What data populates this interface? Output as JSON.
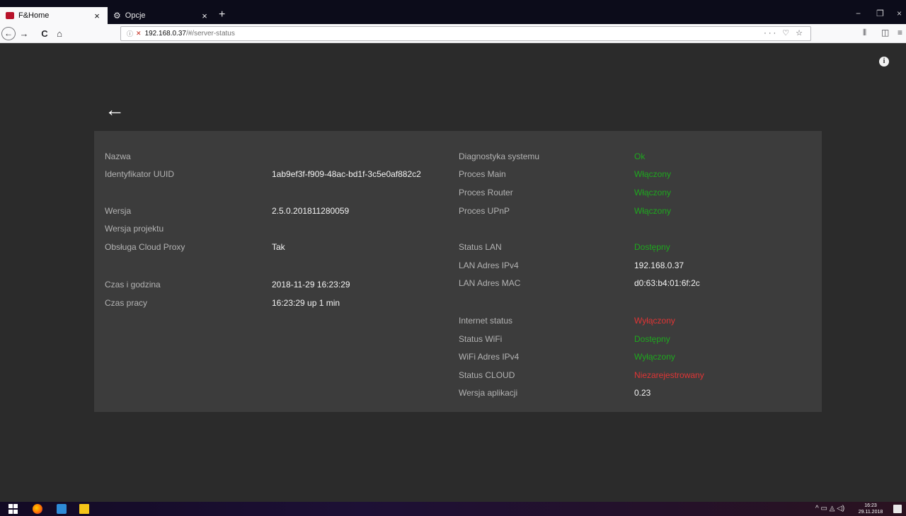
{
  "browser": {
    "tabs": [
      {
        "label": "F&Home"
      },
      {
        "label": "Opcje"
      }
    ],
    "new_tab": "+",
    "tab_close": "×",
    "window_controls": {
      "minimize": "−",
      "restore": "❐",
      "close": "×"
    },
    "nav": {
      "back": "←",
      "forward": "→",
      "reload": "C",
      "home": "⌂"
    },
    "url": {
      "info_glyph": "ⓘ",
      "host": "192.168.0.37",
      "path": "/#/server-status"
    },
    "url_actions": "··· ♡ ☆",
    "toolbar_right": {
      "library": "⫴",
      "sidebar": "◫",
      "menu": "≡"
    }
  },
  "page": {
    "info_icon": "i",
    "back_arrow": "←",
    "left_column": [
      {
        "label": "Nazwa",
        "value": ""
      },
      {
        "label": "Identyfikator UUID",
        "value": "1ab9ef3f-f909-48ac-bd1f-3c5e0af882c2"
      },
      {
        "label": "Wersja",
        "value": "2.5.0.201811280059"
      },
      {
        "label": "Wersja projektu",
        "value": ""
      },
      {
        "label": "Obsługa Cloud Proxy",
        "value": "Tak"
      },
      {
        "label": "Czas i godzina",
        "value": "2018-11-29 16:23:29"
      },
      {
        "label": "Czas pracy",
        "value": "16:23:29 up 1 min"
      }
    ],
    "right_column": [
      {
        "label": "Diagnostyka systemu",
        "value": "Ok",
        "status": "green"
      },
      {
        "label": "Proces Main",
        "value": "Włączony",
        "status": "green"
      },
      {
        "label": "Proces Router",
        "value": "Włączony",
        "status": "green"
      },
      {
        "label": "Proces UPnP",
        "value": "Włączony",
        "status": "green"
      },
      {
        "label": "Status LAN",
        "value": "Dostępny",
        "status": "green"
      },
      {
        "label": "LAN Adres IPv4",
        "value": "192.168.0.37",
        "status": "plain"
      },
      {
        "label": "LAN Adres MAC",
        "value": "d0:63:b4:01:6f:2c",
        "status": "plain"
      },
      {
        "label": "Internet status",
        "value": "Wyłączony",
        "status": "red"
      },
      {
        "label": "Status WiFi",
        "value": "Dostępny",
        "status": "green"
      },
      {
        "label": "WiFi Adres IPv4",
        "value": "Wyłączony",
        "status": "green"
      },
      {
        "label": "Status CLOUD",
        "value": "Niezarejestrowany",
        "status": "red"
      },
      {
        "label": "Wersja aplikacji",
        "value": "0.23",
        "status": "plain"
      }
    ]
  },
  "colors": {
    "status_green": "#1ea81e",
    "status_red": "#e03535",
    "panel_bg": "#3c3c3c",
    "page_bg": "#2b2b2b"
  },
  "taskbar": {
    "tray_icons": "^ ▭ ◬ ◁)",
    "clock_time": "16:23",
    "clock_date": "29.11.2018"
  }
}
